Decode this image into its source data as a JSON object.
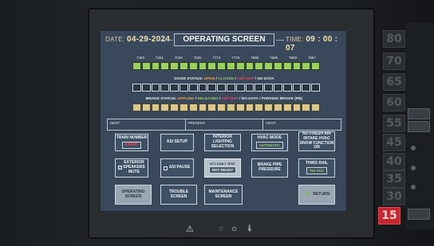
{
  "header": {
    "date_label": "DATE:",
    "date_value": "04-29-2024",
    "title": "OPERATING SCREEN",
    "time_label": "TIME:",
    "time_value": "09 : 00 : 07"
  },
  "cars": [
    "7453",
    "7451",
    "7026",
    "7025",
    "7774",
    "7775",
    "7686",
    "7685",
    "7868",
    "7867"
  ],
  "door_status": {
    "label": "DOOR STATUS:",
    "open": "OPEN",
    "closed": "CLOSED",
    "cutout": "CUT-OUT",
    "nodata": "NO DATA"
  },
  "brake_status": {
    "label": "BRAKE STATUS:",
    "applied": "APPLIED",
    "released": "RELEASED",
    "cutout": "CUT-OUT",
    "nodata": "NO DATA",
    "parking": "PARKING BRAKE (PB)"
  },
  "destination": {
    "dest": "DEST:",
    "present": "PRESENT:",
    "next": "NEXT:"
  },
  "buttons": {
    "train_number_label": "TRAIN NUMBER",
    "train_number_value": "XTRRT",
    "asi_setup": "ASI SETUP",
    "interior_lighting": "INTERIOR LIGHTING SELECTION",
    "hvac_mode_label": "HVAC MODE",
    "hvac_mode_value": "AUTOMATIC",
    "no_fresh_air": "NO FRESH AIR INTAKE HVAC SNOW FUNCTION ON",
    "exterior_speakers": "EXTERIOR SPEAKERS MUTE",
    "asi_pause": "ASI PAUSE",
    "atc_daily_test_label": "ATC DAILY TEST",
    "atc_daily_test_value": "NOT READY",
    "brake_pipe_pressure": "BRAKE PIPE PRESSURE",
    "third_rail_label": "THIRD RAIL",
    "third_rail_value": "750 VDC",
    "operating_screen": "OPERATING SCREEN",
    "trouble_screen": "TROUBLE SCREEN",
    "maintenance_screen": "MAINTENANCE SCREEN",
    "return": "RETURN"
  },
  "speed_scale": [
    "80",
    "70",
    "65",
    "60",
    "55",
    "45",
    "40",
    "35",
    "30",
    "20",
    "15"
  ],
  "speed_lit": "15",
  "colors": {
    "screen_bg": "#39485a",
    "door_green": "#9ad15c",
    "brake_tan": "#d9c88e",
    "accent_orange": "#f3a34a",
    "alert_red": "#f0506a",
    "speed_lit": "#c8262e"
  },
  "icons": {
    "warning": "warning-icon",
    "heart": "heart-icon",
    "power": "power-icon",
    "thermometer": "thermometer-icon"
  }
}
